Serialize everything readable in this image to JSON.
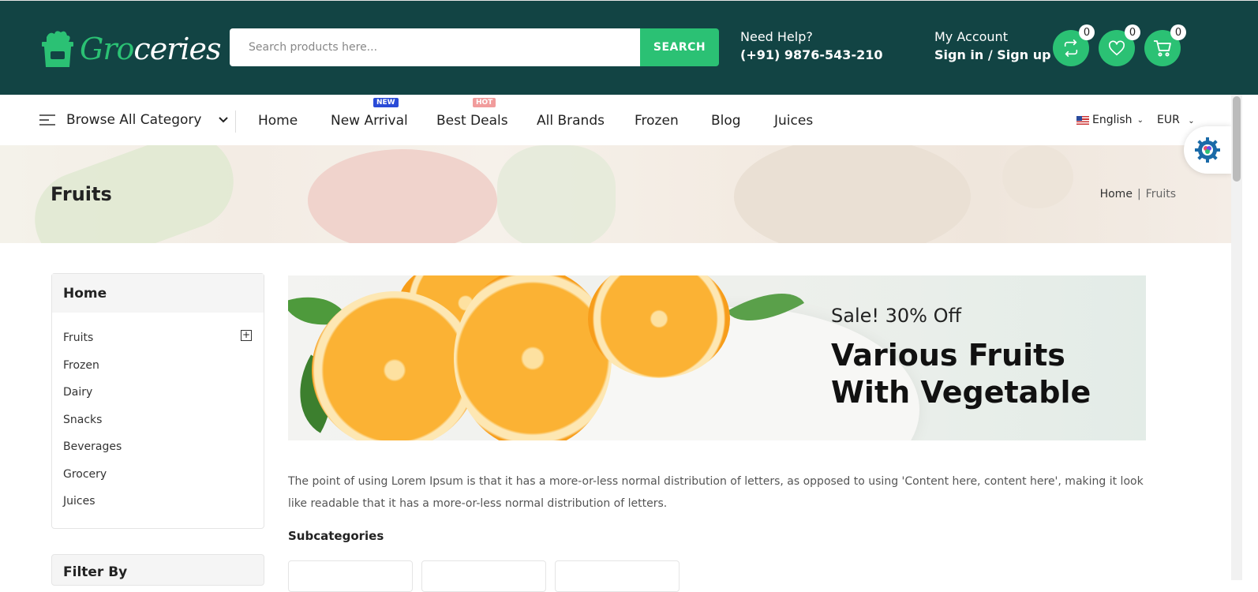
{
  "header": {
    "logo": {
      "part1": "Gro",
      "part2": "ceries"
    },
    "search": {
      "placeholder": "Search products here...",
      "button": "SEARCH"
    },
    "help": {
      "label": "Need Help?",
      "phone": "(+91) 9876-543-210"
    },
    "account": {
      "label": "My Account",
      "link": "Sign in / Sign up"
    },
    "icons": [
      {
        "name": "compare-icon",
        "count": "0"
      },
      {
        "name": "wishlist-icon",
        "count": "0"
      },
      {
        "name": "cart-icon",
        "count": "0"
      }
    ]
  },
  "nav": {
    "browse": "Browse All Category",
    "items": [
      "Home",
      "New Arrival",
      "Best Deals",
      "All Brands",
      "Frozen",
      "Blog",
      "Juices"
    ],
    "tags": {
      "new": "NEW",
      "hot": "HOT"
    },
    "language": "English",
    "currency": "EUR"
  },
  "hero": {
    "title": "Fruits",
    "breadcrumb": {
      "home": "Home",
      "sep": "|",
      "current": "Fruits"
    }
  },
  "sidebar": {
    "title": "Home",
    "categories": [
      "Fruits",
      "Frozen",
      "Dairy",
      "Snacks",
      "Beverages",
      "Grocery",
      "Juices"
    ],
    "filter_title": "Filter By"
  },
  "banner": {
    "sale": "Sale! 30% Off",
    "title": "Various Fruits With Vegetable"
  },
  "content": {
    "description": "The point of using Lorem Ipsum is that it has a more-or-less normal distribution of letters, as opposed to using 'Content here, content here', making it look like readable that it has a more-or-less normal distribution of letters.",
    "subcategories": "Subcategories"
  },
  "colors": {
    "primary": "#124444",
    "accent": "#2bc174"
  }
}
